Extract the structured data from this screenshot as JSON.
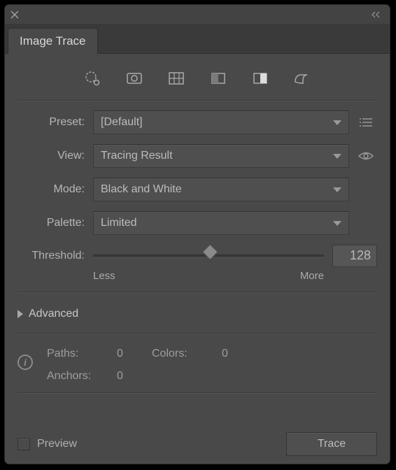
{
  "panel": {
    "title": "Image Trace"
  },
  "presets": {
    "label": "Preset:",
    "value": "[Default]"
  },
  "view": {
    "label": "View:",
    "value": "Tracing Result"
  },
  "mode": {
    "label": "Mode:",
    "value": "Black and White"
  },
  "palette": {
    "label": "Palette:",
    "value": "Limited"
  },
  "threshold": {
    "label": "Threshold:",
    "less": "Less",
    "more": "More",
    "value": "128"
  },
  "advanced": {
    "label": "Advanced"
  },
  "stats": {
    "pathsLabel": "Paths:",
    "paths": "0",
    "colorsLabel": "Colors:",
    "colors": "0",
    "anchorsLabel": "Anchors:",
    "anchors": "0"
  },
  "footer": {
    "preview": "Preview",
    "trace": "Trace"
  }
}
